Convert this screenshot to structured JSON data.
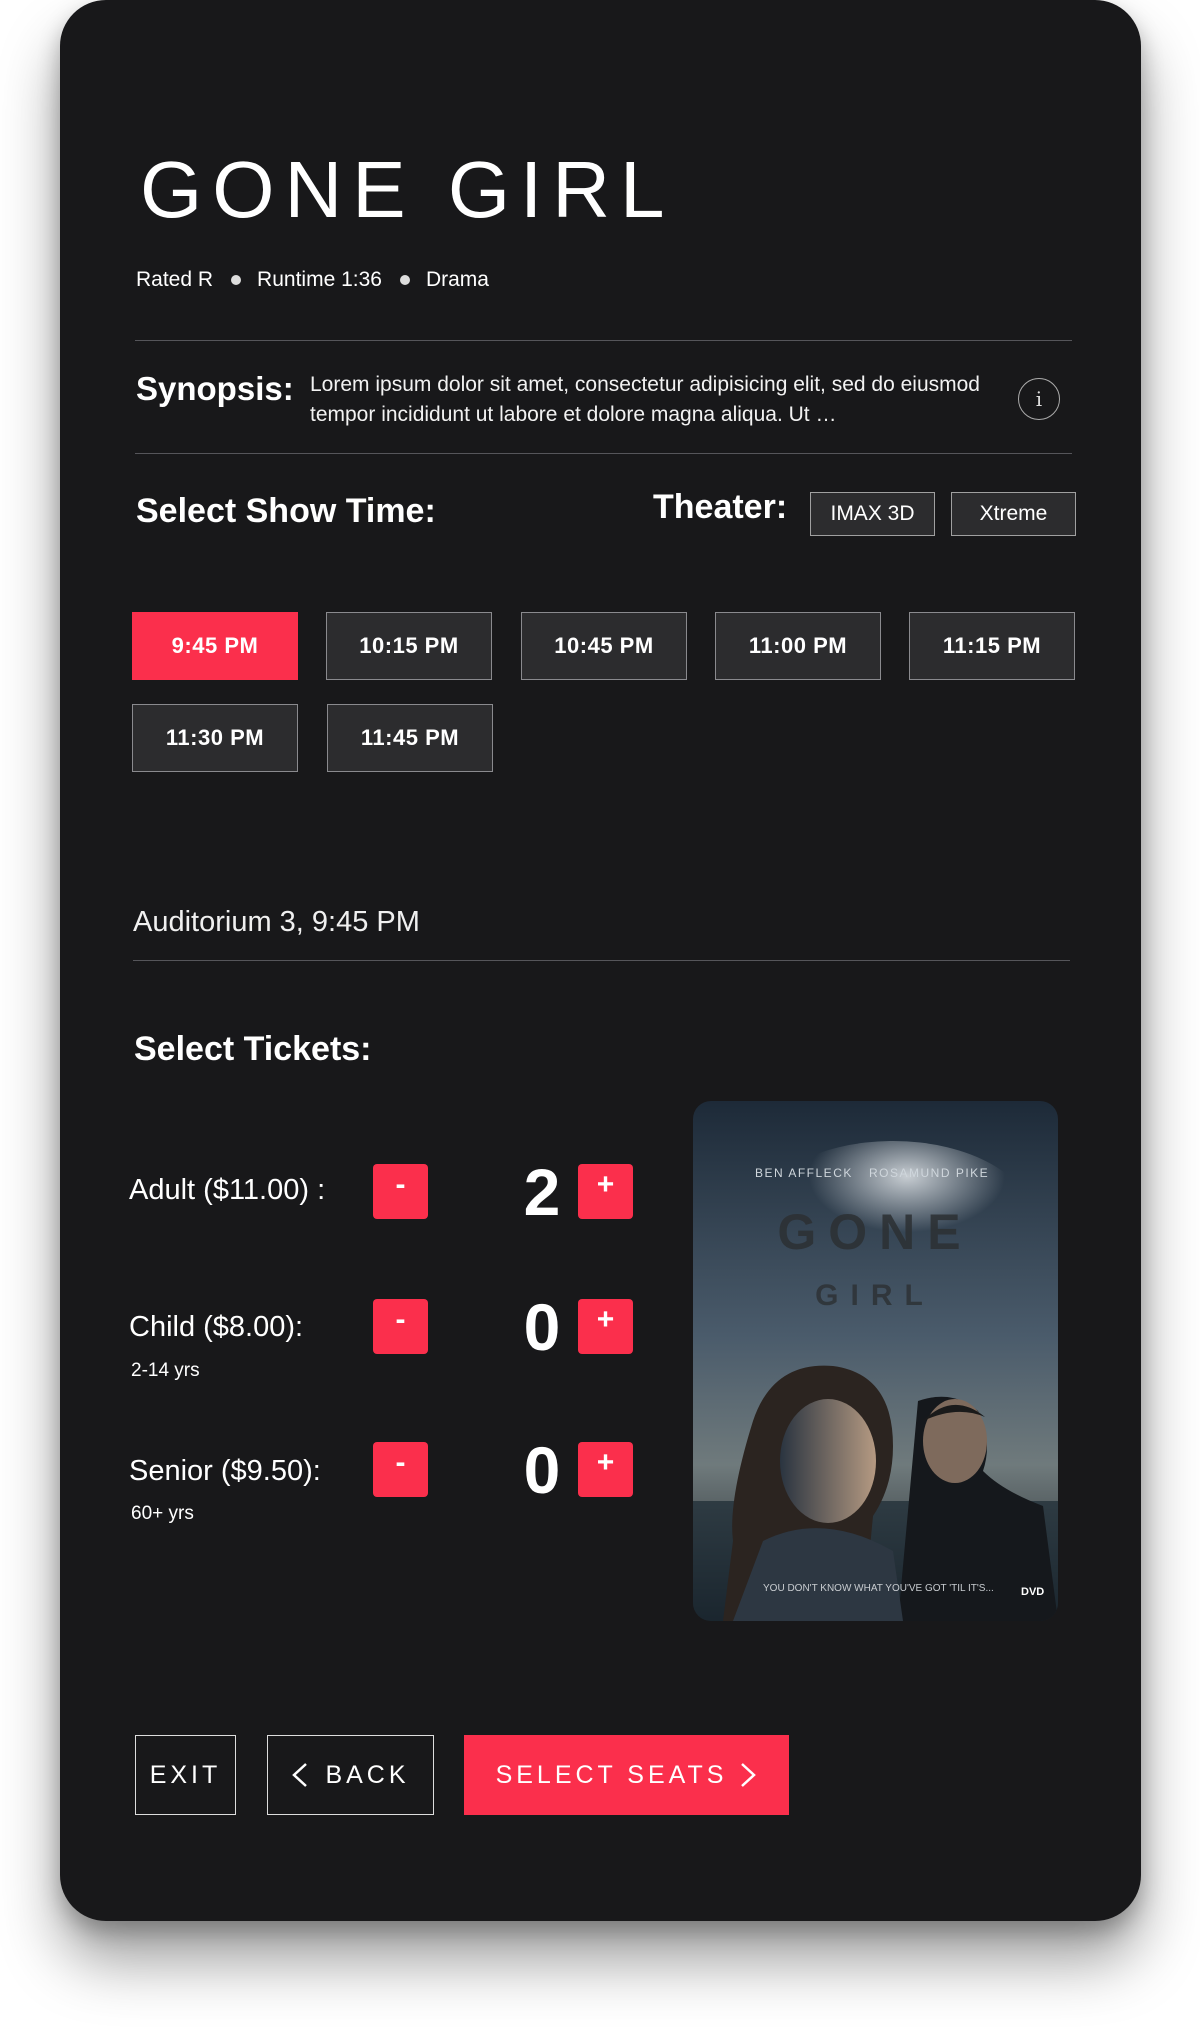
{
  "movie": {
    "title": "GONE GIRL",
    "rating": "Rated R",
    "runtime": "Runtime 1:36",
    "genre": "Drama"
  },
  "synopsis": {
    "label": "Synopsis:",
    "text": "Lorem ipsum dolor sit amet, consectetur adipisicing elit, sed do eiusmod tempor incididunt ut labore et dolore magna aliqua. Ut …",
    "info_icon": "i"
  },
  "showtimes": {
    "heading": "Select Show Time:",
    "theater_label": "Theater:",
    "theaters": [
      "IMAX 3D",
      "Xtreme"
    ],
    "times": [
      "9:45 PM",
      "10:15 PM",
      "10:45 PM",
      "11:00 PM",
      "11:15 PM",
      "11:30 PM",
      "11:45 PM"
    ],
    "selected": "9:45 PM",
    "accent": "#fb2f4c"
  },
  "auditorium": "Auditorium 3, 9:45 PM",
  "tickets": {
    "heading": "Select Tickets:",
    "minus": "-",
    "plus": "+",
    "types": [
      {
        "label": "Adult ($11.00) :",
        "sub": "",
        "count": "2"
      },
      {
        "label": "Child ($8.00):",
        "sub": "2-14 yrs",
        "count": "0"
      },
      {
        "label": "Senior ($9.50):",
        "sub": "60+ yrs",
        "count": "0"
      }
    ]
  },
  "poster": {
    "actors": [
      "BEN AFFLECK",
      "ROSAMUND PIKE"
    ],
    "title_line1": "GONE",
    "title_line2": "GIRL",
    "tagline": "YOU DON'T KNOW WHAT YOU'VE GOT 'TIL IT'S...",
    "badge": "DVD"
  },
  "footer": {
    "exit": "EXIT",
    "back": "BACK",
    "select_seats": "SELECT SEATS",
    "back_icon": "chevron-left-icon",
    "next_icon": "chevron-right-icon"
  }
}
